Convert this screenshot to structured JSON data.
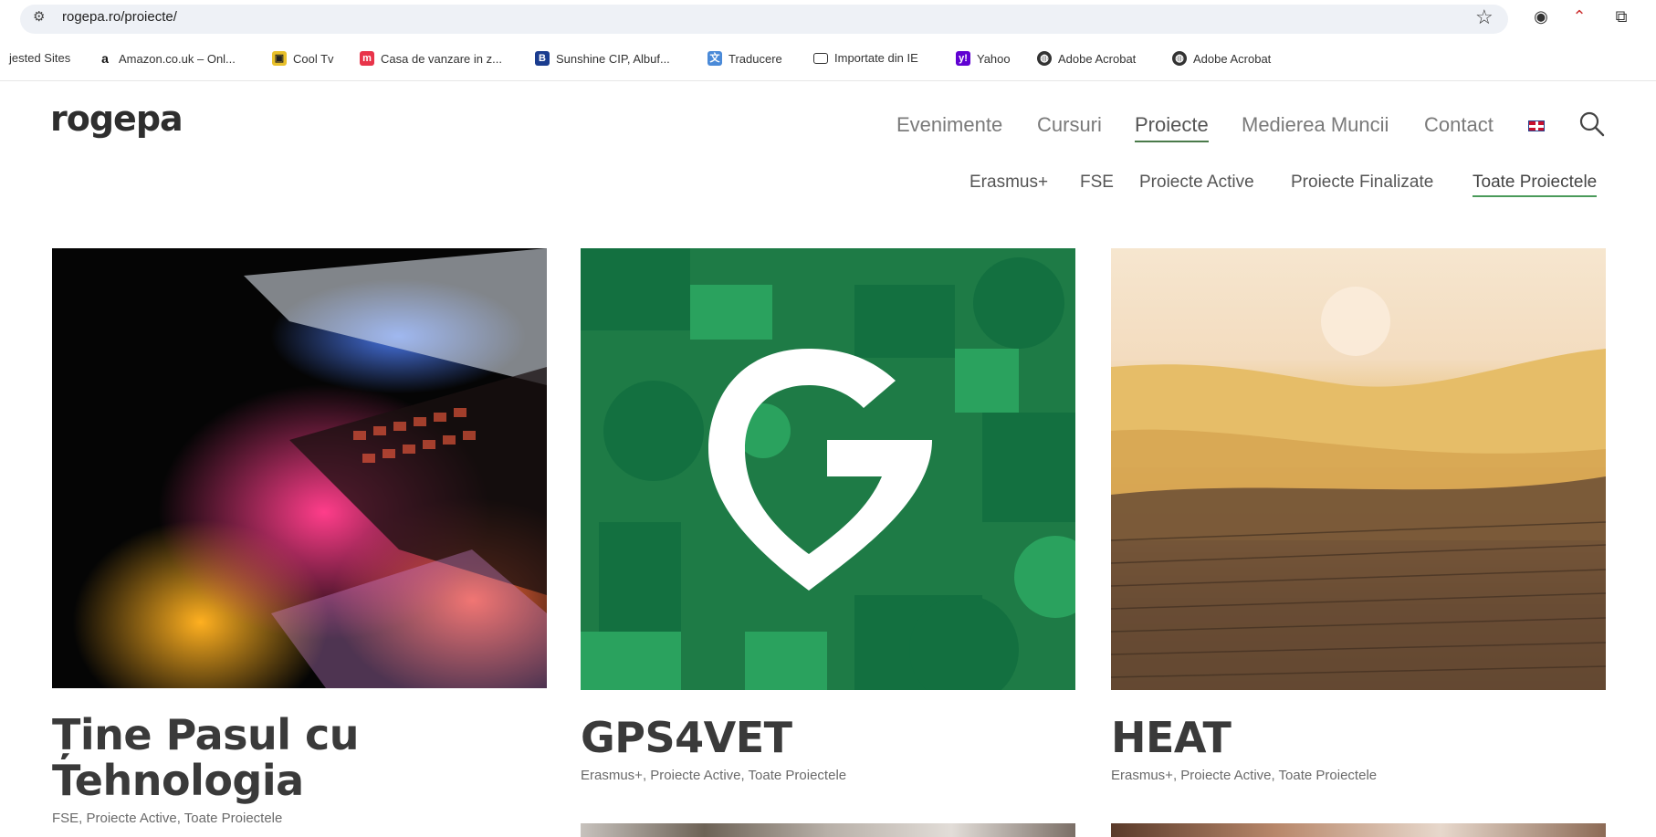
{
  "browser": {
    "url": "rogepa.ro/proiecte/",
    "bookmarks": [
      {
        "label": "jested Sites",
        "icon": "none"
      },
      {
        "label": "Amazon.co.uk – Onl...",
        "icon": "amazon-icon"
      },
      {
        "label": "Cool Tv",
        "icon": "tv-icon"
      },
      {
        "label": "Casa de vanzare in z...",
        "icon": "real-estate-icon"
      },
      {
        "label": "Sunshine CIP, Albuf...",
        "icon": "booking-icon"
      },
      {
        "label": "Traducere",
        "icon": "translate-icon"
      },
      {
        "label": "Importate din IE",
        "icon": "folder-icon"
      },
      {
        "label": "Yahoo",
        "icon": "yahoo-icon"
      },
      {
        "label": "Adobe Acrobat",
        "icon": "globe-icon"
      },
      {
        "label": "Adobe Acrobat",
        "icon": "globe-icon"
      }
    ]
  },
  "site": {
    "logo": "rogepa",
    "nav": [
      "Evenimente",
      "Cursuri",
      "Proiecte",
      "Medierea Muncii",
      "Contact"
    ],
    "active_nav": "Proiecte",
    "subnav": [
      "Erasmus+",
      "FSE",
      "Proiecte Active",
      "Proiecte Finalizate",
      "Toate Proiectele"
    ],
    "active_subnav": "Toate Proiectele"
  },
  "cards": [
    {
      "title_line1": "Ține Pasul cu",
      "title_line2": "Tehnologia",
      "tags": "FSE, Proiecte Active, Toate Proiectele"
    },
    {
      "title_line1": "GPS4VET",
      "tags": "Erasmus+, Proiecte Active, Toate Proiectele"
    },
    {
      "title_line1": "HEAT",
      "tags": "Erasmus+, Proiecte Active, Toate Proiectele"
    }
  ],
  "colors": {
    "accent_green": "#1e7b46",
    "underline_green": "#4a9a5a"
  }
}
